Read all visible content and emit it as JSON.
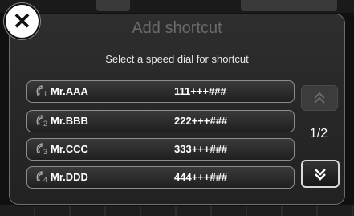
{
  "dialog": {
    "title": "Add shortcut",
    "subtitle": "Select a speed dial for shortcut",
    "close_icon": "close-icon"
  },
  "speed_dials": [
    {
      "index": "1",
      "name": "Mr.AAA",
      "number": "111+++###"
    },
    {
      "index": "2",
      "name": "Mr.BBB",
      "number": "222+++###"
    },
    {
      "index": "3",
      "name": "Mr.CCC",
      "number": "333+++###"
    },
    {
      "index": "4",
      "name": "Mr.DDD",
      "number": "444+++###"
    }
  ],
  "pagination": {
    "page_label": "1/2",
    "up_icon": "double-chevron-up-icon",
    "down_icon": "double-chevron-down-icon"
  }
}
